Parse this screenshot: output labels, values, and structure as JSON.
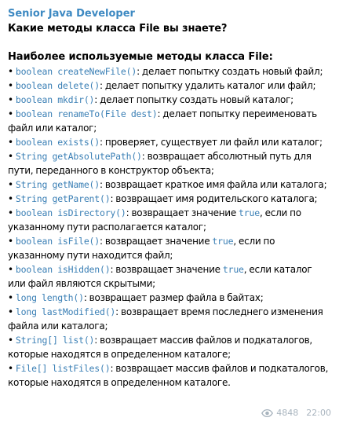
{
  "message": {
    "channel_name": "Senior Java Developer",
    "title": "Какие методы класса File вы знаете?",
    "heading": "Наиболее используемые методы класса File:",
    "items": [
      {
        "bullet": "•",
        "code": "boolean createNewFile()",
        "text": ": делает попытку создать новый файл;"
      },
      {
        "bullet": "•",
        "code": "boolean delete()",
        "text": ": делает попытку удалить каталог или файл;"
      },
      {
        "bullet": "•",
        "code": "boolean mkdir()",
        "text": ": делает попытку создать новый каталог;"
      },
      {
        "bullet": "•",
        "code": "boolean renameTo(File dest)",
        "text": ": делает попытку переименовать файл или каталог;"
      },
      {
        "bullet": "•",
        "code": "boolean exists()",
        "text": ": проверяет, существует ли файл или каталог;"
      },
      {
        "bullet": "•",
        "code": "String getAbsolutePath()",
        "text": ": возвращает абсолютный путь для пути, переданного в конструктор объекта;"
      },
      {
        "bullet": "•",
        "code": "String getName()",
        "text": ": возвращает краткое имя файла или каталога;"
      },
      {
        "bullet": "•",
        "code": "String getParent()",
        "text": ": возвращает имя родительского каталога;"
      },
      {
        "bullet": "•",
        "code": "boolean isDirectory()",
        "text": ": возвращает значение ",
        "code2": "true",
        "text2": ", если по указанному пути располагается каталог;"
      },
      {
        "bullet": "•",
        "code": "boolean isFile()",
        "text": ": возвращает значение ",
        "code2": "true",
        "text2": ", если по указанному пути находится файл;"
      },
      {
        "bullet": "•",
        "code": "boolean isHidden()",
        "text": ": возвращает значение ",
        "code2": "true",
        "text2": ", если каталог или файл являются скрытыми;"
      },
      {
        "bullet": "•",
        "code": "long length()",
        "text": ": возвращает размер файла в байтах;"
      },
      {
        "bullet": "•",
        "code": "long lastModified()",
        "text": ": возвращает время последнего изменения файла или каталога;"
      },
      {
        "bullet": "•",
        "code": "String[] list()",
        "text": ": возвращает массив файлов и подкаталогов, которые находятся в определенном каталоге;"
      },
      {
        "bullet": "•",
        "code": "File[] listFiles()",
        "text": ": возвращает массив файлов и подкаталогов, которые находятся в определенном каталоге."
      }
    ],
    "views": "4848",
    "time": "22:00"
  },
  "colors": {
    "channel_name": "#3d89c2",
    "code": "#3a7fb5",
    "meta": "#a8b4be"
  },
  "icons": {
    "views": "eye-icon"
  }
}
